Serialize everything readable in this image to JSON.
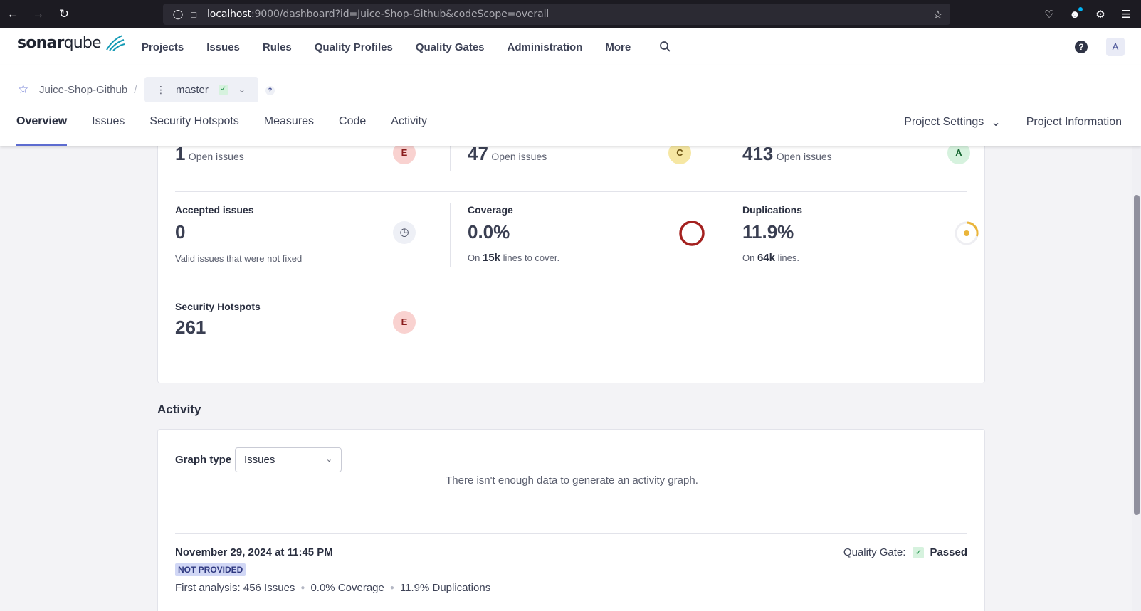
{
  "browser": {
    "url_host": "localhost",
    "url_rest": ":9000/dashboard?id=Juice-Shop-Github&codeScope=overall"
  },
  "header": {
    "logo_a": "sonar",
    "logo_b": "qube",
    "nav": [
      "Projects",
      "Issues",
      "Rules",
      "Quality Profiles",
      "Quality Gates",
      "Administration",
      "More"
    ],
    "avatar": "A",
    "help": "?"
  },
  "project": {
    "name": "Juice-Shop-Github",
    "separator": "/",
    "branch": "master",
    "help": "?",
    "tabs": [
      "Overview",
      "Issues",
      "Security Hotspots",
      "Measures",
      "Code",
      "Activity"
    ],
    "settings": "Project Settings",
    "information": "Project Information"
  },
  "measures": {
    "issues_row": [
      {
        "value": "1",
        "label": "Open issues",
        "rating": "E"
      },
      {
        "value": "47",
        "label": "Open issues",
        "rating": "C"
      },
      {
        "value": "413",
        "label": "Open issues",
        "rating": "A"
      }
    ],
    "accepted": {
      "title": "Accepted issues",
      "value": "0",
      "desc": "Valid issues that were not fixed"
    },
    "coverage": {
      "title": "Coverage",
      "value": "0.0%",
      "desc_pre": "On",
      "desc_val": "15k",
      "desc_post": "lines to cover.",
      "percent": 0.0
    },
    "duplications": {
      "title": "Duplications",
      "value": "11.9%",
      "desc_pre": "On",
      "desc_val": "64k",
      "desc_post": "lines.",
      "percent": 11.9
    },
    "hotspots": {
      "title": "Security Hotspots",
      "value": "261",
      "rating": "E"
    }
  },
  "activity": {
    "title": "Activity",
    "graph_type_label": "Graph type",
    "graph_type_value": "Issues",
    "no_data": "There isn't enough data to generate an activity graph.",
    "date": "November 29, 2024 at 11:45 PM",
    "version_badge": "NOT PROVIDED",
    "quality_gate_label": "Quality Gate:",
    "quality_gate_status": "Passed",
    "summary_prefix": "First analysis:",
    "summary_items": [
      "456 Issues",
      "0.0% Coverage",
      "11.9% Duplications"
    ]
  },
  "colors": {
    "accent": "#5d6cd0",
    "coverage_ring": "#a4211f",
    "duplication_ring": "#eab53a"
  }
}
